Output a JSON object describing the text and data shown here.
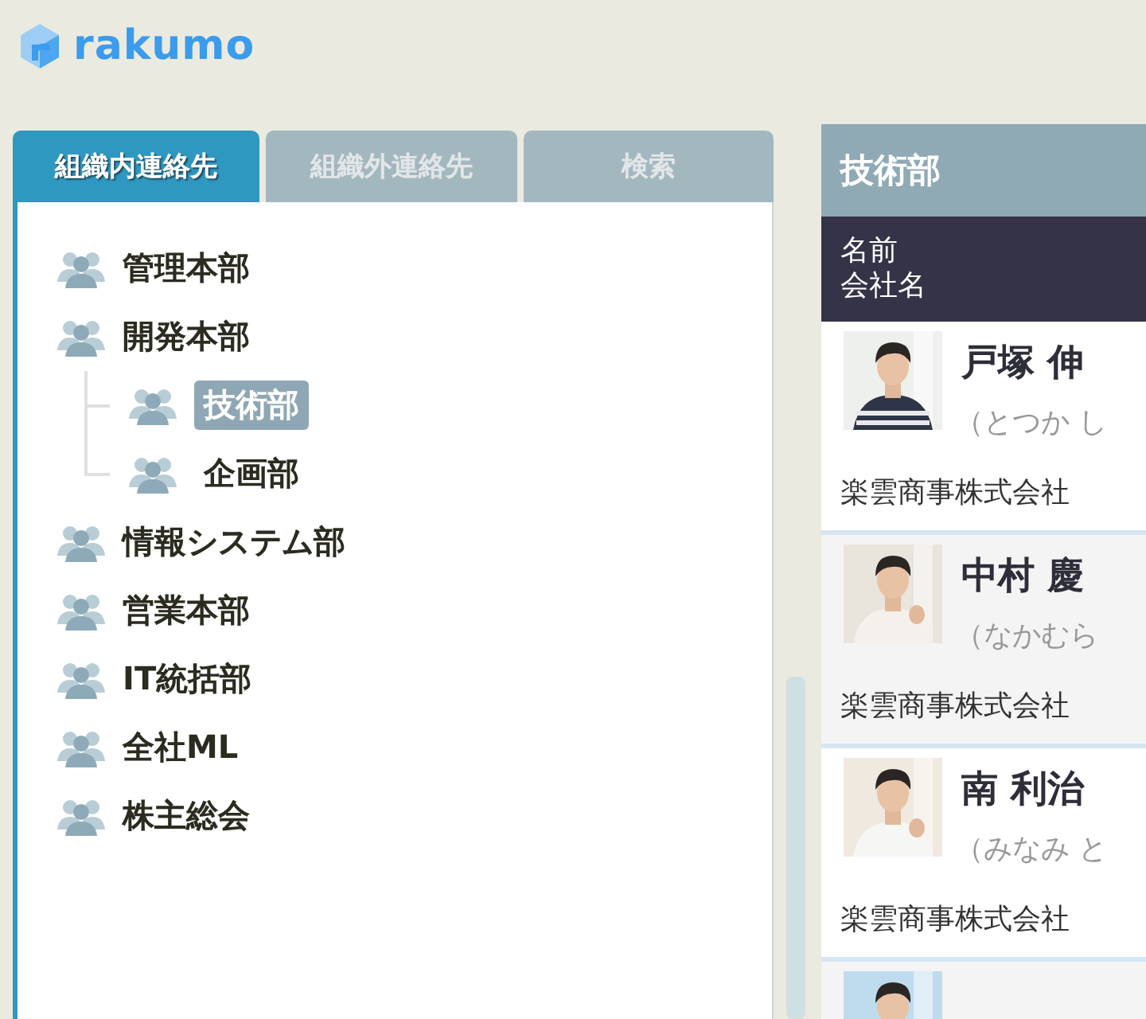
{
  "logo": {
    "text": "rakumo"
  },
  "tabs": [
    {
      "label": "組織内連絡先",
      "selected": true
    },
    {
      "label": "組織外連絡先",
      "selected": false
    },
    {
      "label": "検索",
      "selected": false
    }
  ],
  "tree": [
    {
      "label": "管理本部",
      "selected": false
    },
    {
      "label": "開発本部",
      "selected": false,
      "children": [
        {
          "label": "技術部",
          "selected": true
        },
        {
          "label": "企画部",
          "selected": false
        }
      ]
    },
    {
      "label": "情報システム部",
      "selected": false
    },
    {
      "label": "営業本部",
      "selected": false
    },
    {
      "label": "IT統括部",
      "selected": false
    },
    {
      "label": "全社ML",
      "selected": false
    },
    {
      "label": "株主総会",
      "selected": false
    }
  ],
  "detail": {
    "title": "技術部",
    "columns": [
      "名前",
      "会社名"
    ],
    "contacts": [
      {
        "name": "戸塚 伸",
        "reading": "（とつか し",
        "company": "楽雲商事株式会社",
        "photo": {
          "kind": "picture"
        }
      },
      {
        "name": "中村 慶",
        "reading": "（なかむら",
        "company": "楽雲商事株式会社",
        "photo": {
          "kind": "picture"
        }
      },
      {
        "name": "南 利治",
        "reading": "（みなみ と",
        "company": "楽雲商事株式会社",
        "photo": {
          "kind": "picture"
        }
      },
      {
        "photo": {
          "kind": "picture"
        }
      }
    ]
  }
}
